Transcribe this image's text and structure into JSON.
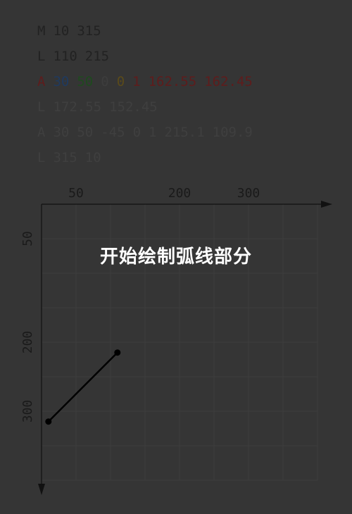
{
  "path_commands": [
    {
      "tokens": [
        {
          "text": "M",
          "color": "#222222"
        },
        {
          "text": "10",
          "color": "#222222"
        },
        {
          "text": "315",
          "color": "#222222"
        }
      ]
    },
    {
      "tokens": [
        {
          "text": "L",
          "color": "#222222"
        },
        {
          "text": "110",
          "color": "#222222"
        },
        {
          "text": "215",
          "color": "#222222"
        }
      ]
    },
    {
      "tokens": [
        {
          "text": "A",
          "color": "#5e1c1c"
        },
        {
          "text": "30",
          "color": "#1f3a5f"
        },
        {
          "text": "50",
          "color": "#1e4a1e"
        },
        {
          "text": "0",
          "color": "#3d3d3d"
        },
        {
          "text": "0",
          "color": "#5a4a1a"
        },
        {
          "text": "1",
          "color": "#5e1c1c"
        },
        {
          "text": "162.55",
          "color": "#5e1c1c"
        },
        {
          "text": "162.45",
          "color": "#5e1c1c"
        }
      ]
    },
    {
      "tokens": [
        {
          "text": "L",
          "color": "#3f3f3f"
        },
        {
          "text": "172.55",
          "color": "#3f3f3f"
        },
        {
          "text": "152.45",
          "color": "#3f3f3f"
        }
      ]
    },
    {
      "tokens": [
        {
          "text": "A",
          "color": "#3f3f3f"
        },
        {
          "text": "30",
          "color": "#3f3f3f"
        },
        {
          "text": "50",
          "color": "#3f3f3f"
        },
        {
          "text": "-45",
          "color": "#3f3f3f"
        },
        {
          "text": "0",
          "color": "#3f3f3f"
        },
        {
          "text": "1",
          "color": "#3f3f3f"
        },
        {
          "text": "215.1",
          "color": "#3f3f3f"
        },
        {
          "text": "109.9",
          "color": "#3f3f3f"
        }
      ]
    },
    {
      "tokens": [
        {
          "text": "L",
          "color": "#3f3f3f"
        },
        {
          "text": "315",
          "color": "#3f3f3f"
        },
        {
          "text": "10",
          "color": "#3f3f3f"
        }
      ]
    }
  ],
  "caption": "开始绘制弧线部分",
  "axis_ticks": {
    "x": [
      {
        "value": 50,
        "label": "50"
      },
      {
        "value": 200,
        "label": "200"
      },
      {
        "value": 300,
        "label": "300"
      }
    ],
    "y": [
      {
        "value": 50,
        "label": "50"
      },
      {
        "value": 200,
        "label": "200"
      },
      {
        "value": 300,
        "label": "300"
      }
    ]
  },
  "grid_step": 50,
  "drawn_segment": {
    "from": [
      10,
      315
    ],
    "to": [
      110,
      215
    ]
  },
  "colors": {
    "background": "#353535",
    "axis": "#111111",
    "grid": "#3d3d3d",
    "tick_label": "#1a1a1a",
    "path": "#000000",
    "caption": "#ffffff"
  }
}
